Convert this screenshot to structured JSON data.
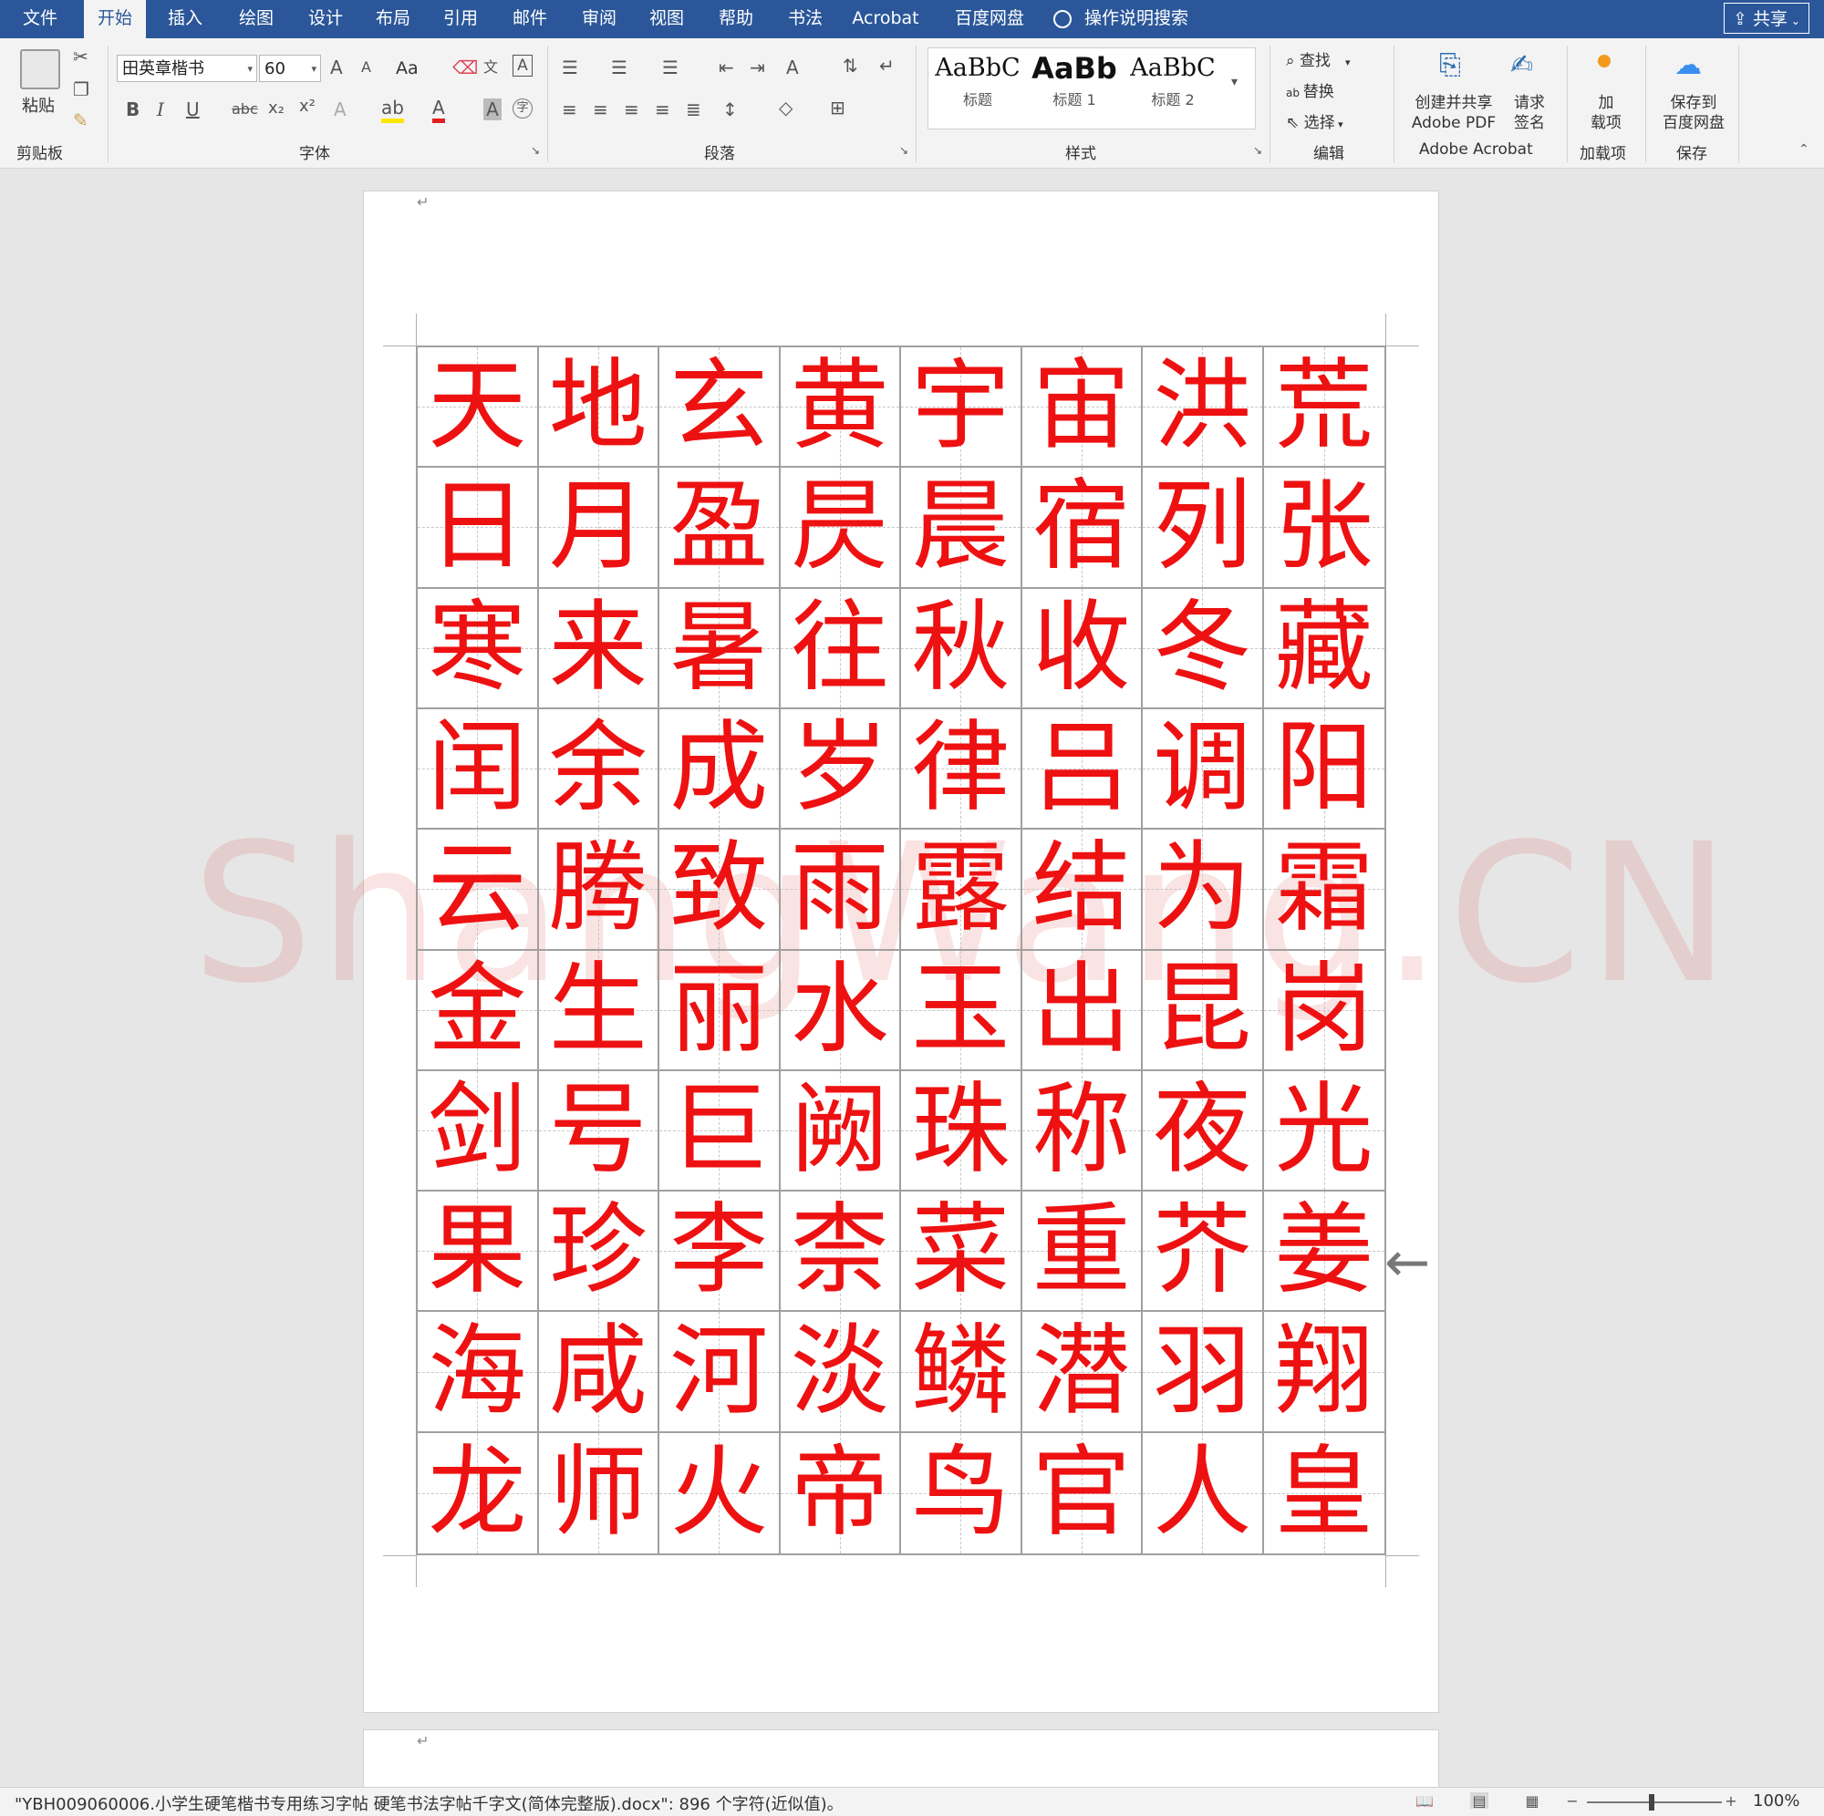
{
  "tabs": [
    {
      "label": "文件",
      "active": false
    },
    {
      "label": "开始",
      "active": true
    },
    {
      "label": "插入",
      "active": false
    },
    {
      "label": "绘图",
      "active": false
    },
    {
      "label": "设计",
      "active": false
    },
    {
      "label": "布局",
      "active": false
    },
    {
      "label": "引用",
      "active": false
    },
    {
      "label": "邮件",
      "active": false
    },
    {
      "label": "审阅",
      "active": false
    },
    {
      "label": "视图",
      "active": false
    },
    {
      "label": "帮助",
      "active": false
    },
    {
      "label": "书法",
      "active": false
    },
    {
      "label": "Acrobat",
      "active": false
    },
    {
      "label": "百度网盘",
      "active": false
    }
  ],
  "tell_me": "操作说明搜索",
  "share": "共享",
  "ribbon": {
    "clipboard": {
      "paste": "粘贴",
      "group": "剪贴板"
    },
    "font": {
      "name": "田英章楷书",
      "size": "60",
      "group": "字体",
      "change_case": "Aa"
    },
    "paragraph": {
      "group": "段落"
    },
    "styles": {
      "group": "样式",
      "items": [
        {
          "sample": "AaBbC",
          "name": "标题"
        },
        {
          "sample": "AaBb",
          "name": "标题 1"
        },
        {
          "sample": "AaBbC",
          "name": "标题 2"
        }
      ]
    },
    "editing": {
      "find": "查找",
      "replace": "替换",
      "select": "选择",
      "group": "编辑"
    },
    "acrobat": {
      "create_share_1": "创建并共享",
      "create_share_2": "Adobe PDF",
      "request_sign_1": "请求",
      "request_sign_2": "签名",
      "group": "Adobe Acrobat"
    },
    "addins": {
      "label_1": "加",
      "label_2": "载项",
      "group": "加载项"
    },
    "save": {
      "label_1": "保存到",
      "label_2": "百度网盘",
      "group": "保存"
    }
  },
  "document": {
    "watermark": "ShangWang.CN",
    "rows": [
      [
        "天",
        "地",
        "玄",
        "黄",
        "宇",
        "宙",
        "洪",
        "荒"
      ],
      [
        "日",
        "月",
        "盈",
        "昃",
        "晨",
        "宿",
        "列",
        "张"
      ],
      [
        "寒",
        "来",
        "暑",
        "往",
        "秋",
        "收",
        "冬",
        "藏"
      ],
      [
        "闰",
        "余",
        "成",
        "岁",
        "律",
        "吕",
        "调",
        "阳"
      ],
      [
        "云",
        "腾",
        "致",
        "雨",
        "露",
        "结",
        "为",
        "霜"
      ],
      [
        "金",
        "生",
        "丽",
        "水",
        "玉",
        "出",
        "昆",
        "岗"
      ],
      [
        "剑",
        "号",
        "巨",
        "阙",
        "珠",
        "称",
        "夜",
        "光"
      ],
      [
        "果",
        "珍",
        "李",
        "柰",
        "菜",
        "重",
        "芥",
        "姜"
      ],
      [
        "海",
        "咸",
        "河",
        "淡",
        "鳞",
        "潜",
        "羽",
        "翔"
      ],
      [
        "龙",
        "师",
        "火",
        "帝",
        "鸟",
        "官",
        "人",
        "皇"
      ]
    ],
    "char_color": "#ee1111"
  },
  "status": {
    "text": "\"YBH009060006.小学生硬笔楷书专用练习字帖 硬笔书法字帖千字文(简体完整版).docx\": 896 个字符(近似值)。",
    "zoom": "100%"
  }
}
